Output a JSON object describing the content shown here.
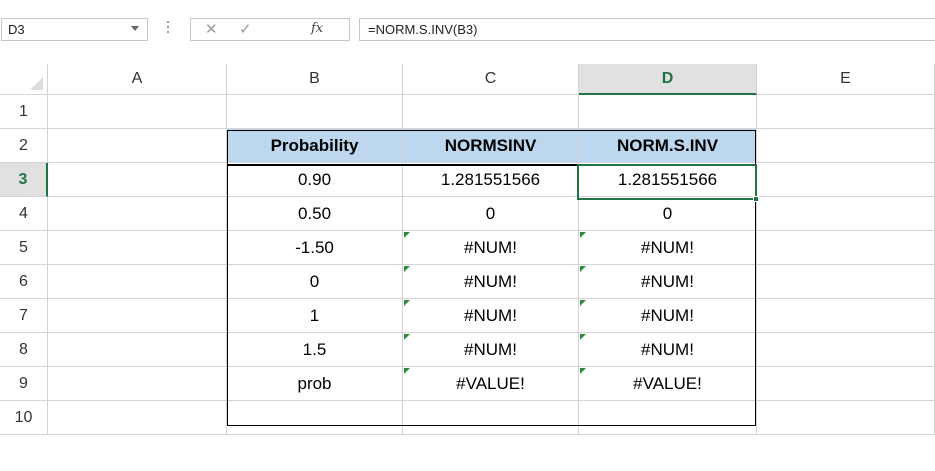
{
  "name_box": {
    "value": "D3"
  },
  "formula_bar": {
    "cancel_glyph": "✕",
    "enter_glyph": "✓",
    "fx_label": "fx",
    "formula": "=NORM.S.INV(B3)"
  },
  "columns": [
    "A",
    "B",
    "C",
    "D",
    "E"
  ],
  "selected_column": "D",
  "rows": [
    "1",
    "2",
    "3",
    "4",
    "5",
    "6",
    "7",
    "8",
    "9",
    "10"
  ],
  "selected_row": "3",
  "table": {
    "headers": [
      "Probability",
      "NORMSINV",
      "NORM.S.INV"
    ],
    "rows": [
      [
        "0.90",
        "1.281551566",
        "1.281551566"
      ],
      [
        "0.50",
        "0",
        "0"
      ],
      [
        "-1.50",
        "#NUM!",
        "#NUM!"
      ],
      [
        "0",
        "#NUM!",
        "#NUM!"
      ],
      [
        "1",
        "#NUM!",
        "#NUM!"
      ],
      [
        "1.5",
        "#NUM!",
        "#NUM!"
      ],
      [
        "prob",
        "#VALUE!",
        "#VALUE!"
      ]
    ],
    "error_indicator_rows": [
      2,
      3,
      4,
      5,
      6
    ]
  },
  "colors": {
    "header_fill": "#bdd7ee",
    "selection_green": "#217346",
    "error_triangle": "#2e8b3e"
  }
}
